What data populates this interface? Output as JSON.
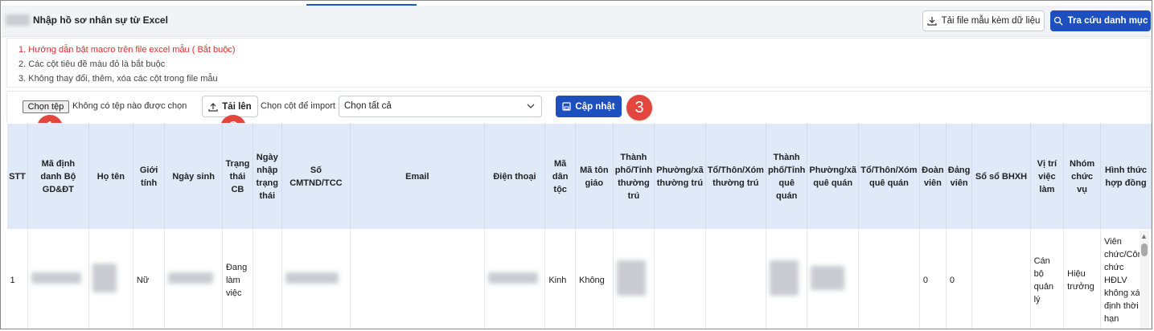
{
  "header": {
    "title": "Nhập hồ sơ nhân sự từ Excel",
    "download_template_label": "Tải file mẫu kèm dữ liệu",
    "lookup_label": "Tra cứu danh mục"
  },
  "notes": [
    "1. Hướng dẫn bật macro trên file excel mẫu ( Bắt buộc)",
    "2. Các cột tiêu đề màu đỏ là bắt buộc",
    "3. Không thay đổi, thêm, xóa các cột trong file mẫu"
  ],
  "toolbar": {
    "file_button": "Chọn tệp",
    "file_status": "Không có tệp nào được chọn",
    "upload_label": "Tải lên",
    "column_select_label": "Chọn cột để import",
    "column_select_value": "Chọn tất cả",
    "update_label": "Cập nhật"
  },
  "steps": [
    "1",
    "2",
    "3"
  ],
  "table": {
    "columns": [
      "STT",
      "Mã định danh Bộ GD&ĐT",
      "Họ tên",
      "Giới tính",
      "Ngày sinh",
      "Trạng thái CB",
      "Ngày nhập trạng thái",
      "Số CMTND/TCC",
      "Email",
      "Điện thoại",
      "Mã dân tộc",
      "Mã tôn giáo",
      "Thành phố/Tỉnh thường trú",
      "Phường/xã thường trú",
      "Tổ/Thôn/Xóm thường trú",
      "Thành phố/Tỉnh quê quán",
      "Phường/xã quê quán",
      "Tổ/Thôn/Xóm quê quán",
      "Đoàn viên",
      "Đảng viên",
      "Sổ sổ BHXH",
      "Vị trí việc làm",
      "Nhóm chức vụ",
      "Hình thức hợp đồng"
    ],
    "row": {
      "stt": "1",
      "gioi_tinh": "Nữ",
      "trang_thai": "Đang làm việc",
      "dan_toc": "Kinh",
      "ton_giao": "Không",
      "doan_vien": "0",
      "dang_vien": "0",
      "vi_tri": "Cán bộ quản lý",
      "nhom_chuc_vu": "Hiệu trưởng",
      "hinh_thuc": "Viên chức/Công chức HĐLV không xác định thời hạn"
    }
  },
  "colors": {
    "primary": "#1e4fbf",
    "header_bg": "#e0e9f8",
    "required_note": "#e12b2b",
    "step_badge": "#e2463d"
  },
  "icons": {
    "download": "download-icon",
    "search": "search-icon",
    "upload": "upload-icon",
    "save": "save-icon",
    "chevron": "chevron-down-icon"
  }
}
